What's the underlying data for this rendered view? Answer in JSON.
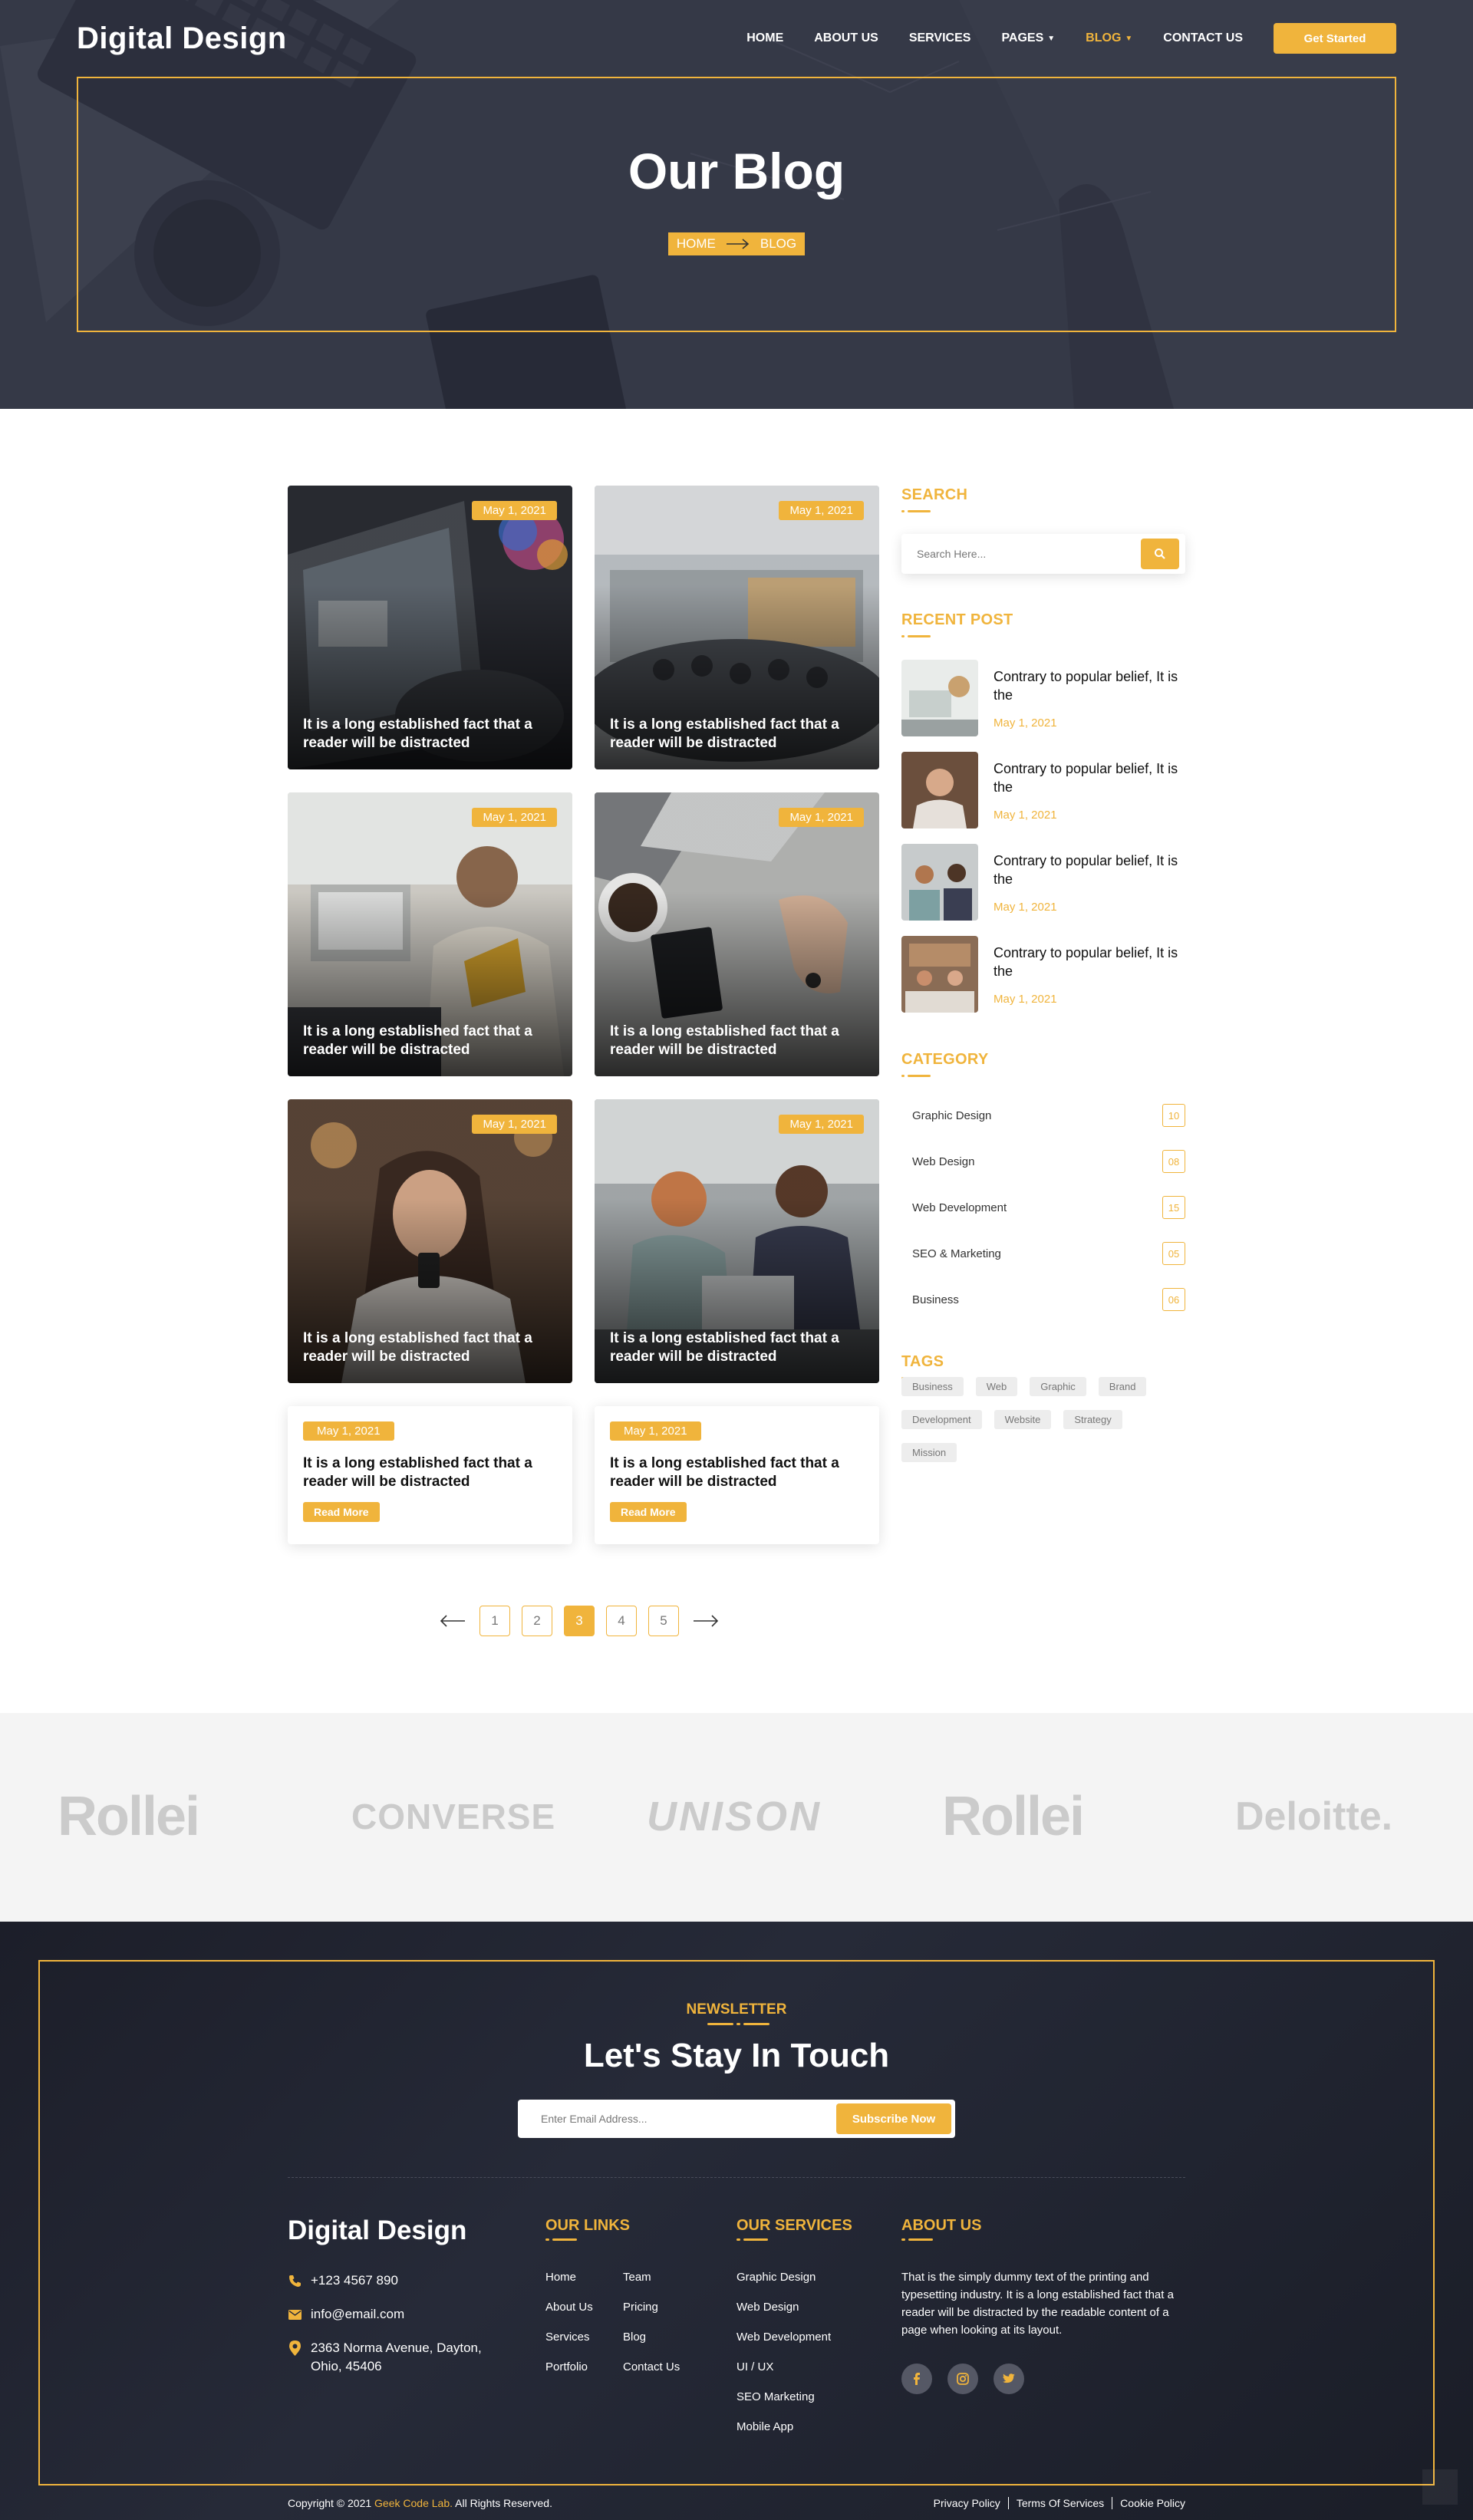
{
  "header": {
    "logo": "Digital Design",
    "nav": [
      "HOME",
      "ABOUT US",
      "SERVICES",
      "PAGES",
      "BLOG",
      "CONTACT US"
    ],
    "cta": "Get Started"
  },
  "hero": {
    "title": "Our Blog",
    "breadcrumb": [
      "HOME",
      "BLOG"
    ]
  },
  "posts": [
    {
      "date": "May 1, 2021",
      "title": "It is a long established fact that a reader will be distracted"
    },
    {
      "date": "May 1, 2021",
      "title": "It is a long established fact that a reader will be distracted"
    },
    {
      "date": "May 1, 2021",
      "title": "It is a long established fact that a reader will be distracted"
    },
    {
      "date": "May 1, 2021",
      "title": "It is a long established fact that a reader will be distracted"
    },
    {
      "date": "May 1, 2021",
      "title": "It is a long established fact that a reader will be distracted"
    },
    {
      "date": "May 1, 2021",
      "title": "It is a long established fact that a reader will be distracted"
    },
    {
      "date": "May 1, 2021",
      "title": "It is a long established fact that a reader will be distracted",
      "cta": "Read More"
    },
    {
      "date": "May 1, 2021",
      "title": "It is a long established fact that a reader will be distracted",
      "cta": "Read More"
    }
  ],
  "pagination": {
    "pages": [
      "1",
      "2",
      "3",
      "4",
      "5"
    ],
    "current": "3"
  },
  "sidebar": {
    "search_heading": "SEARCH",
    "search_placeholder": "Search Here...",
    "recent_heading": "RECENT POST",
    "recent": [
      {
        "title": "Contrary to popular belief, It is the",
        "date": "May 1, 2021"
      },
      {
        "title": "Contrary to popular belief, It is the",
        "date": "May 1, 2021"
      },
      {
        "title": "Contrary to popular belief, It is the",
        "date": "May 1, 2021"
      },
      {
        "title": "Contrary to popular belief, It is the",
        "date": "May 1, 2021"
      }
    ],
    "category_heading": "CATEGORY",
    "categories": [
      {
        "name": "Graphic Design",
        "count": "10"
      },
      {
        "name": "Web Design",
        "count": "08"
      },
      {
        "name": "Web Development",
        "count": "15"
      },
      {
        "name": "SEO & Marketing",
        "count": "05"
      },
      {
        "name": "Business",
        "count": "06"
      }
    ],
    "tags_heading": "TAGS",
    "tags": [
      "Business",
      "Web",
      "Graphic",
      "Brand",
      "Development",
      "Website",
      "Strategy",
      "Mission"
    ]
  },
  "brands": [
    "Rollei",
    "CONVERSE",
    "UNISON",
    "Rollei",
    "Deloitte."
  ],
  "newsletter": {
    "label": "NEWSLETTER",
    "title": "Let's Stay In Touch",
    "placeholder": "Enter Email Address...",
    "button": "Subscribe Now"
  },
  "footer": {
    "logo": "Digital Design",
    "phone": "+123 4567 890",
    "email": "info@email.com",
    "address_line1": "2363 Norma Avenue, Dayton,",
    "address_line2": "Ohio, 45406",
    "links_heading": "OUR LINKS",
    "links": [
      "Home",
      "Team",
      "About Us",
      "Pricing",
      "Services",
      "Blog",
      "Portfolio",
      "Contact Us"
    ],
    "services_heading": "OUR SERVICES",
    "services": [
      "Graphic Design",
      "Web Design",
      "Web Development",
      "UI / UX",
      "SEO Marketing",
      "Mobile App"
    ],
    "about_heading": "ABOUT US",
    "about_text": "That is the simply dummy text of the printing and typesetting industry. It is a long established fact that a reader will be distracted by the readable content of a page when looking at its layout.",
    "social": [
      "facebook-icon",
      "instagram-icon",
      "twitter-icon"
    ],
    "copyright_prefix": "Copyright © 2021",
    "copyright_brand": "Geek Code Lab.",
    "copyright_suffix": "All Rights Reserved.",
    "legal": [
      "Privacy Policy",
      "Terms Of Services",
      "Cookie Policy"
    ]
  },
  "colors": {
    "accent": "#f0b43c",
    "dark": "#1c1e29",
    "light_bg": "#f4f4f4"
  }
}
